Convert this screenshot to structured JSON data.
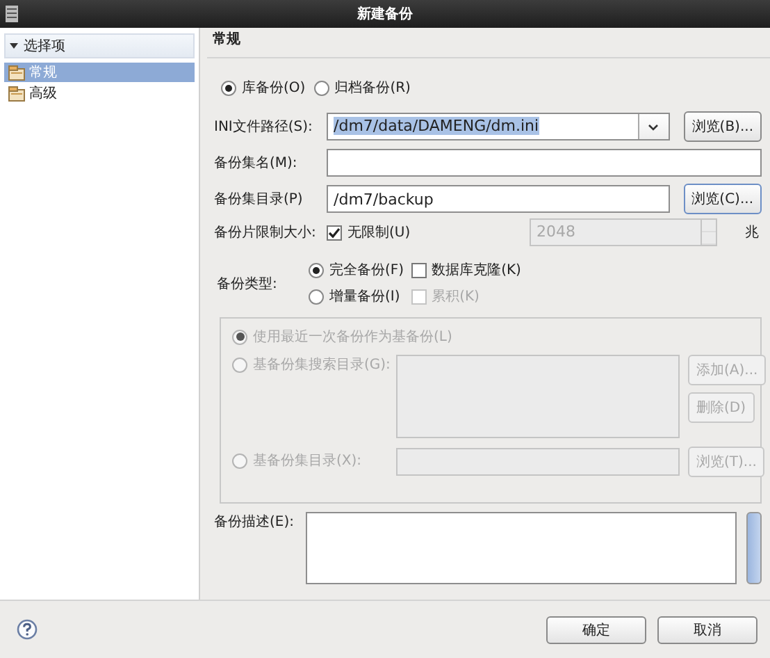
{
  "window": {
    "title": "新建备份"
  },
  "sidebar": {
    "header": "选择项",
    "expanded": true,
    "items": [
      {
        "label": "常规",
        "selected": true
      },
      {
        "label": "高级",
        "selected": false
      }
    ]
  },
  "section_title": "常规",
  "backup_scope": [
    {
      "label": "库备份(O)",
      "selected": true
    },
    {
      "label": "归档备份(R)",
      "selected": false
    }
  ],
  "ini_path": {
    "label": "INI文件路径(S):",
    "value": "/dm7/data/DAMENG/dm.ini",
    "browse": "浏览(B)..."
  },
  "backup_name": {
    "label": "备份集名(M):"
  },
  "backup_dir": {
    "label": "备份集目录(P)",
    "value": "/dm7/backup",
    "browse": "浏览(C)..."
  },
  "size_limit": {
    "label": "备份片限制大小:",
    "unlimited": {
      "label": "无限制(U)",
      "checked": true
    },
    "value": "2048",
    "unit": "兆"
  },
  "backup_type": {
    "label": "备份类型:",
    "options": [
      {
        "label": "完全备份(F)",
        "selected": true
      },
      {
        "label": "增量备份(I)",
        "selected": false
      }
    ],
    "clone": {
      "label": "数据库克隆(K)",
      "checked": false
    },
    "cumulative": {
      "label": "累积(K)",
      "checked": false,
      "disabled": true
    }
  },
  "base_backup": {
    "disabled": true,
    "options": [
      {
        "kind": "recent",
        "label": "使用最近一次备份作为基备份(L)",
        "selected": true
      },
      {
        "kind": "search_dirs",
        "label": "基备份集搜索目录(G):",
        "selected": false,
        "buttons": [
          "添加(A)...",
          "删除(D)"
        ]
      },
      {
        "kind": "dir",
        "label": "基备份集目录(X):",
        "selected": false,
        "buttons": [
          "浏览(T)..."
        ]
      }
    ]
  },
  "description": {
    "label": "备份描述(E):"
  },
  "buttons": [
    "确定",
    "取消"
  ]
}
